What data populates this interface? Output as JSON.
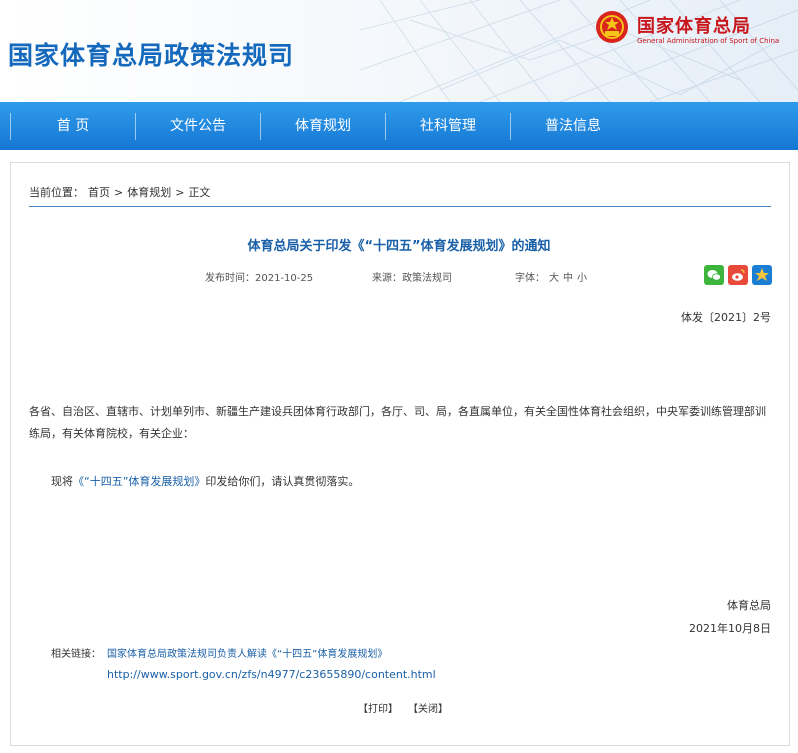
{
  "header": {
    "site_title": "国家体育总局政策法规司",
    "org_name": "国家体育总局",
    "org_name_en": "General Administration of Sport of China"
  },
  "nav": {
    "items": [
      {
        "label": "首  页"
      },
      {
        "label": "文件公告"
      },
      {
        "label": "体育规划"
      },
      {
        "label": "社科管理"
      },
      {
        "label": "普法信息"
      }
    ]
  },
  "breadcrumb": {
    "prefix": "当前位置：",
    "items": [
      "首页",
      "体育规划",
      "正文"
    ],
    "separator": ">"
  },
  "article": {
    "title": "体育总局关于印发《“十四五”体育发展规划》的通知",
    "publish_label": "发布时间：2021-10-25",
    "source_label": "来源：政策法规司",
    "font_label": "字体：",
    "font_sizes": [
      "大",
      "中",
      "小"
    ],
    "doc_number": "体发〔2021〕2号",
    "recipients": "各省、自治区、直辖市、计划单列市、新疆生产建设兵团体育行政部门，各厅、司、局，各直属单位，有关全国性体育社会组织，中央军委训练管理部训练局，有关体育院校，有关企业：",
    "body_prefix": "现将",
    "body_link": "《“十四五”体育发展规划》",
    "body_suffix": "印发给你们，请认真贯彻落实。",
    "signature": "体育总局",
    "date": "2021年10月8日"
  },
  "related": {
    "label": "相关链接：",
    "link_text": "国家体育总局政策法规司负责人解读《“十四五”体育发展规划》",
    "url": "http://www.sport.gov.cn/zfs/n4977/c23655890/content.html"
  },
  "actions": {
    "print": "【打印】",
    "close": "【关闭】"
  },
  "share": {
    "icons": [
      "wechat-icon",
      "weibo-icon",
      "qzone-icon"
    ],
    "colors": {
      "wechat": "#3db53d",
      "weibo": "#e8493a",
      "qzone": "#1a7fd4"
    }
  },
  "colors": {
    "brand_blue": "#1469bc",
    "nav_blue": "#1577d4",
    "brand_red": "#c8161d",
    "link_blue": "#1a60a8"
  }
}
